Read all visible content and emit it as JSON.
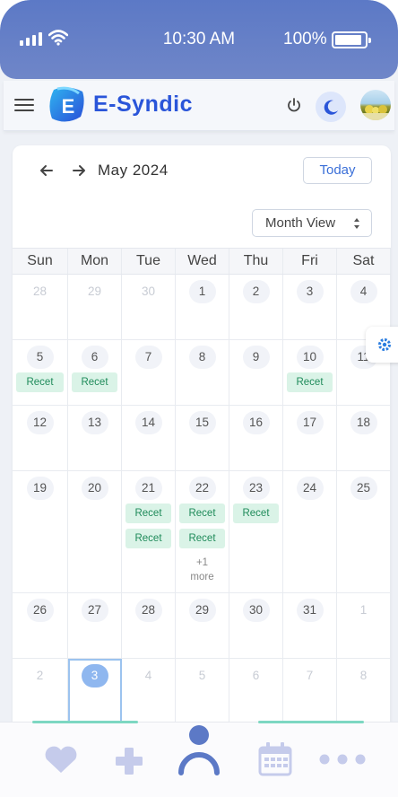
{
  "status_bar": {
    "time": "10:30 AM",
    "battery": "100%"
  },
  "header": {
    "brand": "E-Syndic",
    "logo_letter": "E"
  },
  "calendar": {
    "title": "May 2024",
    "today_label": "Today",
    "view_label": "Month View",
    "weekdays": [
      "Sun",
      "Mon",
      "Tue",
      "Wed",
      "Thu",
      "Fri",
      "Sat"
    ],
    "weeks": [
      [
        {
          "n": "28",
          "o": true
        },
        {
          "n": "29",
          "o": true
        },
        {
          "n": "30",
          "o": true
        },
        {
          "n": "1"
        },
        {
          "n": "2"
        },
        {
          "n": "3"
        },
        {
          "n": "4"
        }
      ],
      [
        {
          "n": "5",
          "e": [
            "Recet"
          ]
        },
        {
          "n": "6",
          "e": [
            "Recet"
          ]
        },
        {
          "n": "7"
        },
        {
          "n": "8"
        },
        {
          "n": "9"
        },
        {
          "n": "10",
          "e": [
            "Recet"
          ]
        },
        {
          "n": "11"
        }
      ],
      [
        {
          "n": "12"
        },
        {
          "n": "13"
        },
        {
          "n": "14"
        },
        {
          "n": "15"
        },
        {
          "n": "16"
        },
        {
          "n": "17"
        },
        {
          "n": "18"
        }
      ],
      [
        {
          "n": "19"
        },
        {
          "n": "20"
        },
        {
          "n": "21",
          "e": [
            "Recet",
            "Recet"
          ]
        },
        {
          "n": "22",
          "e": [
            "Recet",
            "Recet"
          ],
          "more": "+1 more"
        },
        {
          "n": "23",
          "e": [
            "Recet"
          ]
        },
        {
          "n": "24"
        },
        {
          "n": "25"
        }
      ],
      [
        {
          "n": "26"
        },
        {
          "n": "27"
        },
        {
          "n": "28"
        },
        {
          "n": "29"
        },
        {
          "n": "30"
        },
        {
          "n": "31"
        },
        {
          "n": "1",
          "o": true
        }
      ],
      [
        {
          "n": "2",
          "o": true
        },
        {
          "n": "3",
          "o": true,
          "today": true
        },
        {
          "n": "4",
          "o": true
        },
        {
          "n": "5",
          "o": true
        },
        {
          "n": "6",
          "o": true
        },
        {
          "n": "7",
          "o": true
        },
        {
          "n": "8",
          "o": true
        }
      ]
    ]
  },
  "bottom_nav": {
    "items": [
      {
        "icon": "heart-icon"
      },
      {
        "icon": "plus-icon"
      },
      {
        "icon": "user-icon"
      },
      {
        "icon": "calendar-icon"
      },
      {
        "icon": "more-dots-icon"
      }
    ]
  },
  "colors": {
    "brand": "#2a55d9",
    "event_bg": "#daf3e7",
    "event_text": "#1f8b5a",
    "nav_icon": "#c5cbeb",
    "nav_active": "#5c79c6"
  }
}
